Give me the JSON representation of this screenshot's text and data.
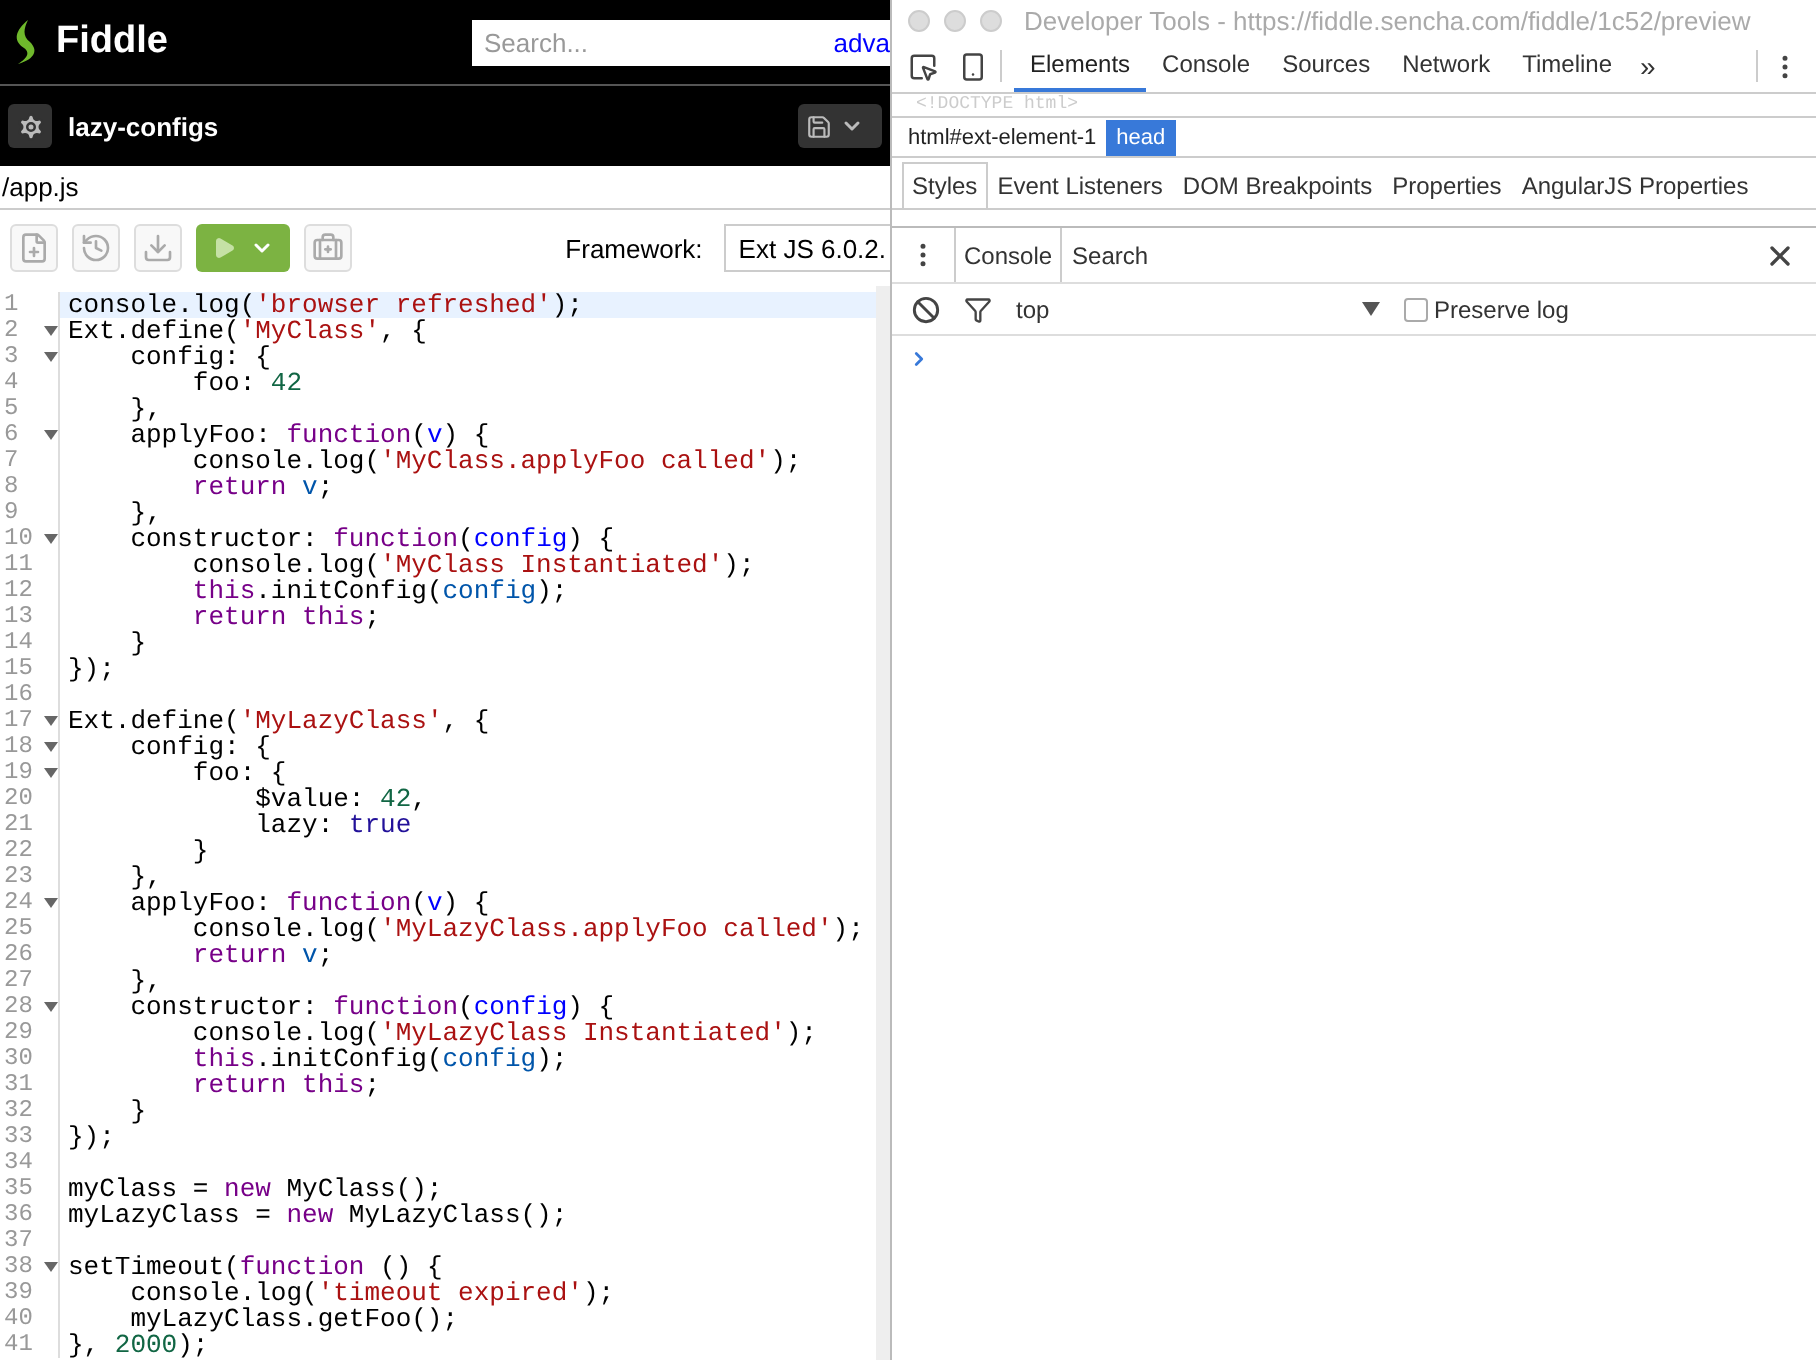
{
  "header": {
    "logo": "Fiddle",
    "search": {
      "placeholder": "Search..."
    },
    "advanced_link": "adva"
  },
  "fiddle_bar": {
    "name": "lazy-configs"
  },
  "file_tab": {
    "label": "/app.js",
    "selected": true
  },
  "toolbar": {
    "framework_label": "Framework:",
    "framework_value": "Ext JS 6.0.2."
  },
  "code_lines": [
    {
      "number": "1",
      "foldable": false,
      "active": true,
      "tokens": [
        {
          "kind": "plain",
          "text": "console.log("
        },
        {
          "kind": "string",
          "text": "'browser refreshed'"
        },
        {
          "kind": "plain",
          "text": ");"
        }
      ]
    },
    {
      "number": "2",
      "foldable": true,
      "active": false,
      "tokens": [
        {
          "kind": "plain",
          "text": "Ext.define("
        },
        {
          "kind": "string",
          "text": "'MyClass'"
        },
        {
          "kind": "plain",
          "text": ", {"
        }
      ]
    },
    {
      "number": "3",
      "foldable": true,
      "active": false,
      "tokens": [
        {
          "kind": "plain",
          "text": "    config: {"
        }
      ]
    },
    {
      "number": "4",
      "foldable": false,
      "active": false,
      "tokens": [
        {
          "kind": "plain",
          "text": "        foo: "
        },
        {
          "kind": "number",
          "text": "42"
        }
      ]
    },
    {
      "number": "5",
      "foldable": false,
      "active": false,
      "tokens": [
        {
          "kind": "plain",
          "text": "    },"
        }
      ]
    },
    {
      "number": "6",
      "foldable": true,
      "active": false,
      "tokens": [
        {
          "kind": "plain",
          "text": "    applyFoo: "
        },
        {
          "kind": "keyword",
          "text": "function"
        },
        {
          "kind": "plain",
          "text": "("
        },
        {
          "kind": "def",
          "text": "v"
        },
        {
          "kind": "plain",
          "text": ") {"
        }
      ]
    },
    {
      "number": "7",
      "foldable": false,
      "active": false,
      "tokens": [
        {
          "kind": "plain",
          "text": "        console.log("
        },
        {
          "kind": "string",
          "text": "'MyClass.applyFoo called'"
        },
        {
          "kind": "plain",
          "text": ");"
        }
      ]
    },
    {
      "number": "8",
      "foldable": false,
      "active": false,
      "tokens": [
        {
          "kind": "keyword",
          "text": "        return "
        },
        {
          "kind": "variable",
          "text": "v"
        },
        {
          "kind": "plain",
          "text": ";"
        }
      ]
    },
    {
      "number": "9",
      "foldable": false,
      "active": false,
      "tokens": [
        {
          "kind": "plain",
          "text": "    },"
        }
      ]
    },
    {
      "number": "10",
      "foldable": true,
      "active": false,
      "tokens": [
        {
          "kind": "plain",
          "text": "    constructor: "
        },
        {
          "kind": "keyword",
          "text": "function"
        },
        {
          "kind": "plain",
          "text": "("
        },
        {
          "kind": "def",
          "text": "config"
        },
        {
          "kind": "plain",
          "text": ") {"
        }
      ]
    },
    {
      "number": "11",
      "foldable": false,
      "active": false,
      "tokens": [
        {
          "kind": "plain",
          "text": "        console.log("
        },
        {
          "kind": "string",
          "text": "'MyClass Instantiated'"
        },
        {
          "kind": "plain",
          "text": ");"
        }
      ]
    },
    {
      "number": "12",
      "foldable": false,
      "active": false,
      "tokens": [
        {
          "kind": "keyword",
          "text": "        this"
        },
        {
          "kind": "plain",
          "text": ".initConfig("
        },
        {
          "kind": "variable",
          "text": "config"
        },
        {
          "kind": "plain",
          "text": ");"
        }
      ]
    },
    {
      "number": "13",
      "foldable": false,
      "active": false,
      "tokens": [
        {
          "kind": "keyword",
          "text": "        return this"
        },
        {
          "kind": "plain",
          "text": ";"
        }
      ]
    },
    {
      "number": "14",
      "foldable": false,
      "active": false,
      "tokens": [
        {
          "kind": "plain",
          "text": "    }"
        }
      ]
    },
    {
      "number": "15",
      "foldable": false,
      "active": false,
      "tokens": [
        {
          "kind": "plain",
          "text": "});"
        }
      ]
    },
    {
      "number": "16",
      "foldable": false,
      "active": false
    },
    {
      "number": "17",
      "foldable": true,
      "active": false,
      "tokens": [
        {
          "kind": "plain",
          "text": "Ext.define("
        },
        {
          "kind": "string",
          "text": "'MyLazyClass'"
        },
        {
          "kind": "plain",
          "text": ", {"
        }
      ]
    },
    {
      "number": "18",
      "foldable": true,
      "active": false,
      "tokens": [
        {
          "kind": "plain",
          "text": "    config: {"
        }
      ]
    },
    {
      "number": "19",
      "foldable": true,
      "active": false,
      "tokens": [
        {
          "kind": "plain",
          "text": "        foo: {"
        }
      ]
    },
    {
      "number": "20",
      "foldable": false,
      "active": false,
      "tokens": [
        {
          "kind": "plain",
          "text": "            $value: "
        },
        {
          "kind": "number",
          "text": "42"
        },
        {
          "kind": "plain",
          "text": ","
        }
      ]
    },
    {
      "number": "21",
      "foldable": false,
      "active": false,
      "tokens": [
        {
          "kind": "plain",
          "text": "            lazy: "
        },
        {
          "kind": "atom",
          "text": "true"
        }
      ]
    },
    {
      "number": "22",
      "foldable": false,
      "active": false,
      "tokens": [
        {
          "kind": "plain",
          "text": "        }"
        }
      ]
    },
    {
      "number": "23",
      "foldable": false,
      "active": false,
      "tokens": [
        {
          "kind": "plain",
          "text": "    },"
        }
      ]
    },
    {
      "number": "24",
      "foldable": true,
      "active": false,
      "tokens": [
        {
          "kind": "plain",
          "text": "    applyFoo: "
        },
        {
          "kind": "keyword",
          "text": "function"
        },
        {
          "kind": "plain",
          "text": "("
        },
        {
          "kind": "def",
          "text": "v"
        },
        {
          "kind": "plain",
          "text": ") {"
        }
      ]
    },
    {
      "number": "25",
      "foldable": false,
      "active": false,
      "tokens": [
        {
          "kind": "plain",
          "text": "        console.log("
        },
        {
          "kind": "string",
          "text": "'MyLazyClass.applyFoo called'"
        },
        {
          "kind": "plain",
          "text": ");"
        }
      ]
    },
    {
      "number": "26",
      "foldable": false,
      "active": false,
      "tokens": [
        {
          "kind": "keyword",
          "text": "        return "
        },
        {
          "kind": "variable",
          "text": "v"
        },
        {
          "kind": "plain",
          "text": ";"
        }
      ]
    },
    {
      "number": "27",
      "foldable": false,
      "active": false,
      "tokens": [
        {
          "kind": "plain",
          "text": "    },"
        }
      ]
    },
    {
      "number": "28",
      "foldable": true,
      "active": false,
      "tokens": [
        {
          "kind": "plain",
          "text": "    constructor: "
        },
        {
          "kind": "keyword",
          "text": "function"
        },
        {
          "kind": "plain",
          "text": "("
        },
        {
          "kind": "def",
          "text": "config"
        },
        {
          "kind": "plain",
          "text": ") {"
        }
      ]
    },
    {
      "number": "29",
      "foldable": false,
      "active": false,
      "tokens": [
        {
          "kind": "plain",
          "text": "        console.log("
        },
        {
          "kind": "string",
          "text": "'MyLazyClass Instantiated'"
        },
        {
          "kind": "plain",
          "text": ");"
        }
      ]
    },
    {
      "number": "30",
      "foldable": false,
      "active": false,
      "tokens": [
        {
          "kind": "keyword",
          "text": "        this"
        },
        {
          "kind": "plain",
          "text": ".initConfig("
        },
        {
          "kind": "variable",
          "text": "config"
        },
        {
          "kind": "plain",
          "text": ");"
        }
      ]
    },
    {
      "number": "31",
      "foldable": false,
      "active": false,
      "tokens": [
        {
          "kind": "keyword",
          "text": "        return this"
        },
        {
          "kind": "plain",
          "text": ";"
        }
      ]
    },
    {
      "number": "32",
      "foldable": false,
      "active": false,
      "tokens": [
        {
          "kind": "plain",
          "text": "    }"
        }
      ]
    },
    {
      "number": "33",
      "foldable": false,
      "active": false,
      "tokens": [
        {
          "kind": "plain",
          "text": "});"
        }
      ]
    },
    {
      "number": "34",
      "foldable": false,
      "active": false
    },
    {
      "number": "35",
      "foldable": false,
      "active": false,
      "tokens": [
        {
          "kind": "plain",
          "text": "myClass = "
        },
        {
          "kind": "keyword",
          "text": "new"
        },
        {
          "kind": "plain",
          "text": " MyClass();"
        }
      ]
    },
    {
      "number": "36",
      "foldable": false,
      "active": false,
      "tokens": [
        {
          "kind": "plain",
          "text": "myLazyClass = "
        },
        {
          "kind": "keyword",
          "text": "new"
        },
        {
          "kind": "plain",
          "text": " MyLazyClass();"
        }
      ]
    },
    {
      "number": "37",
      "foldable": false,
      "active": false
    },
    {
      "number": "38",
      "foldable": true,
      "active": false,
      "tokens": [
        {
          "kind": "plain",
          "text": "setTimeout("
        },
        {
          "kind": "keyword",
          "text": "function"
        },
        {
          "kind": "plain",
          "text": " () {"
        }
      ]
    },
    {
      "number": "39",
      "foldable": false,
      "active": false,
      "tokens": [
        {
          "kind": "plain",
          "text": "    console.log("
        },
        {
          "kind": "string",
          "text": "'timeout expired'"
        },
        {
          "kind": "plain",
          "text": ");"
        }
      ]
    },
    {
      "number": "40",
      "foldable": false,
      "active": false,
      "tokens": [
        {
          "kind": "plain",
          "text": "    myLazyClass.getFoo();"
        }
      ]
    },
    {
      "number": "41",
      "foldable": false,
      "active": false,
      "tokens": [
        {
          "kind": "plain",
          "text": "}, "
        },
        {
          "kind": "number",
          "text": "2000"
        },
        {
          "kind": "plain",
          "text": ");"
        }
      ]
    }
  ],
  "devtools": {
    "title": "Developer Tools - https://fiddle.sencha.com/fiddle/1c52/preview",
    "tabs": [
      {
        "label": "Elements",
        "selected": true
      },
      {
        "label": "Console",
        "selected": false
      },
      {
        "label": "Sources",
        "selected": false
      },
      {
        "label": "Network",
        "selected": false
      },
      {
        "label": "Timeline",
        "selected": false
      }
    ],
    "overflow": "»",
    "source_line": "<!DOCTYPE html>",
    "breadcrumbs": [
      {
        "label": "html#ext-element-1",
        "selected": false
      },
      {
        "label": "head",
        "selected": true
      }
    ],
    "sidebar_tabs": [
      {
        "label": "Styles",
        "selected": true
      },
      {
        "label": "Event Listeners",
        "selected": false
      },
      {
        "label": "DOM Breakpoints",
        "selected": false
      },
      {
        "label": "Properties",
        "selected": false
      },
      {
        "label": "AngularJS Properties",
        "selected": false
      }
    ],
    "drawer_tabs": [
      {
        "label": "Console",
        "selected": true
      },
      {
        "label": "Search",
        "selected": false
      }
    ],
    "context": "top",
    "preserve_log": {
      "label": "Preserve log",
      "checked": false
    }
  }
}
